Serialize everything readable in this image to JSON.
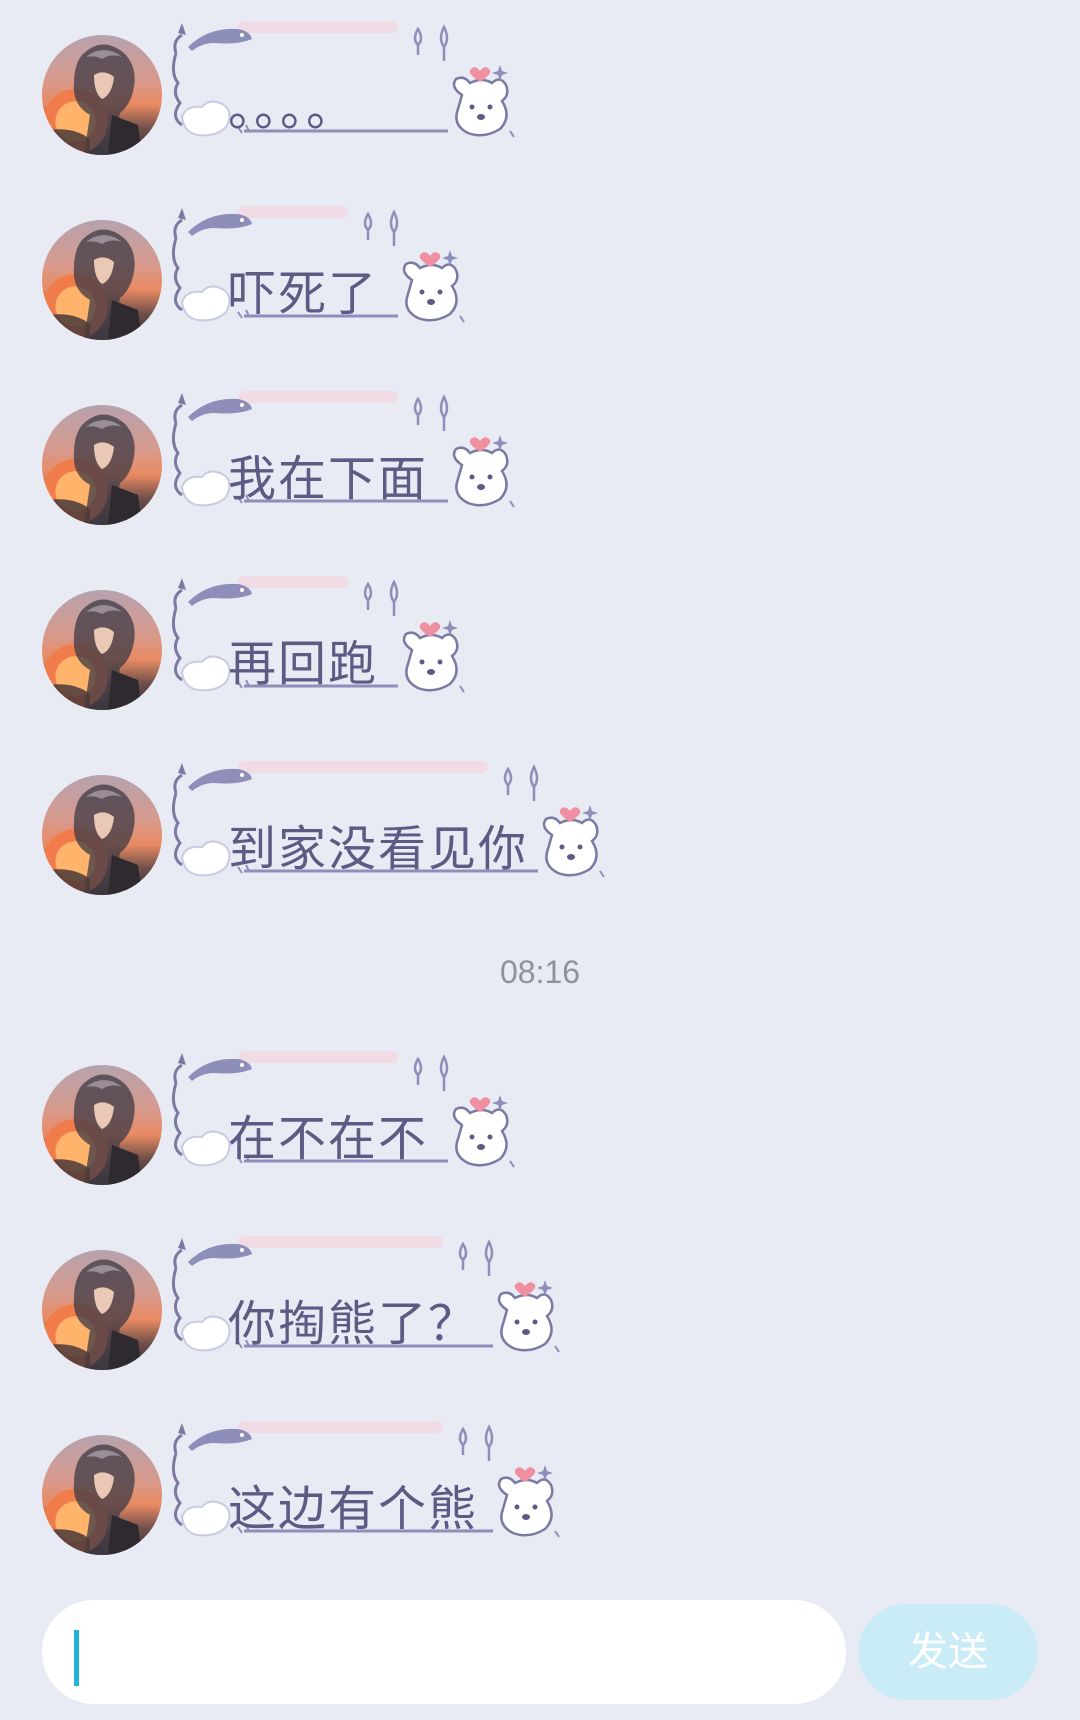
{
  "messages": [
    {
      "text": "。。。。",
      "bubble_width": 340
    },
    {
      "text": "吓死了",
      "bubble_width": 290
    },
    {
      "text": "我在下面",
      "bubble_width": 340
    },
    {
      "text": "再回跑",
      "bubble_width": 290
    },
    {
      "text": "到家没看见你",
      "bubble_width": 430
    },
    {
      "text": "在不在不",
      "bubble_width": 340
    },
    {
      "text": "你掏熊了？",
      "bubble_width": 385
    },
    {
      "text": "这边有个熊",
      "bubble_width": 385
    }
  ],
  "timestamp": "08:16",
  "composer": {
    "input_value": "",
    "send_label": "发送"
  },
  "colors": {
    "background": "#e8ebf4",
    "bubble_text": "#5d5a84",
    "send_button": "#c9ecf7",
    "caret": "#20b5d6"
  },
  "icons": [
    "avatar-image",
    "fish-decoration-icon",
    "bear-sticker-icon",
    "heart-icon",
    "sparkle-icon"
  ]
}
